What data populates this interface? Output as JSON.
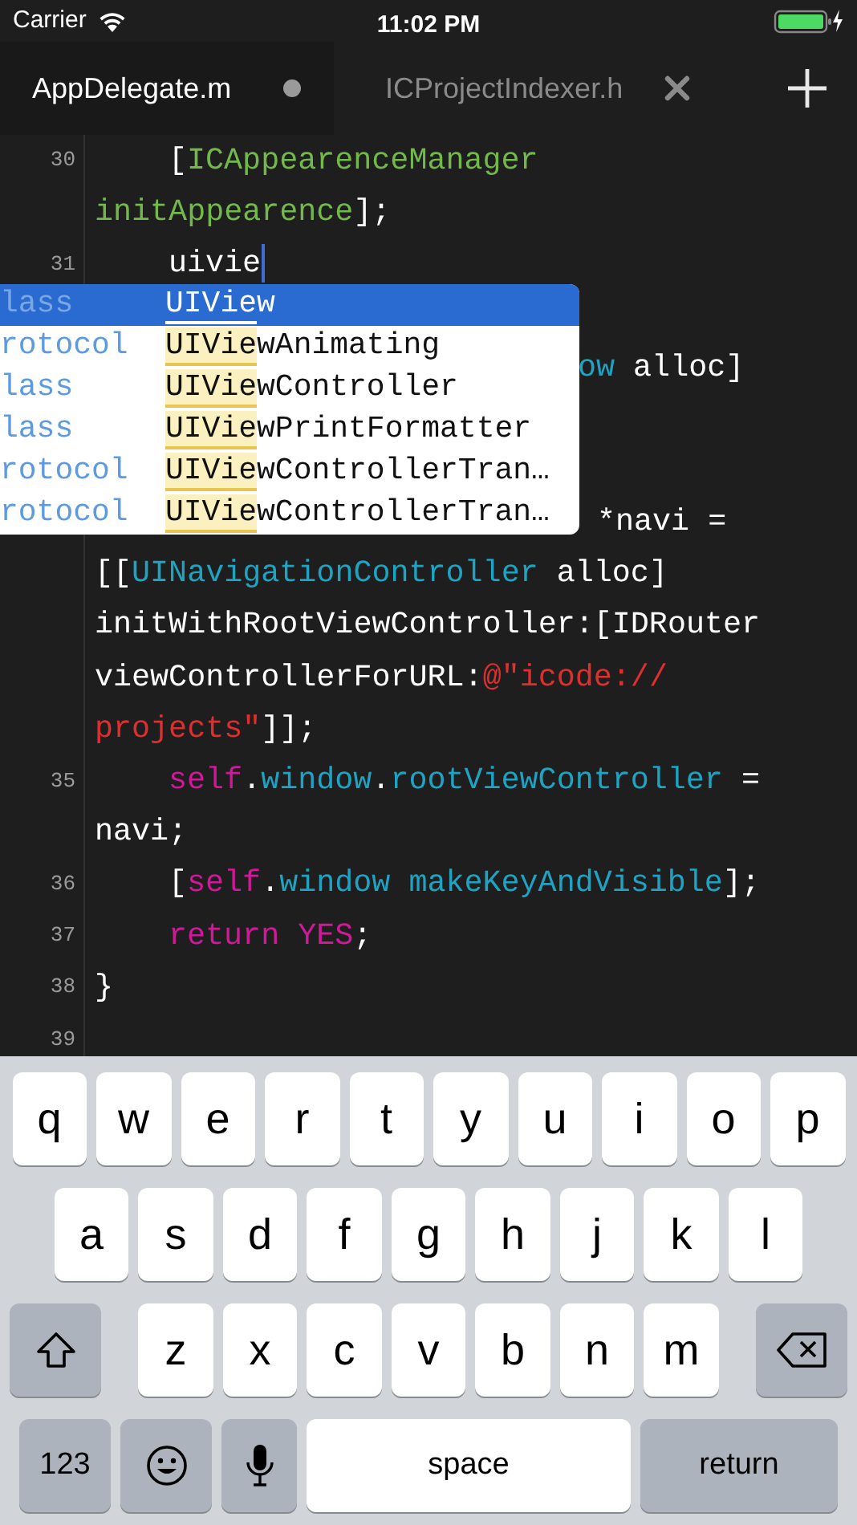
{
  "status_bar": {
    "carrier": "Carrier",
    "time": "11:02 PM"
  },
  "tabs": [
    {
      "label": "AppDelegate.m",
      "selected": true,
      "kind": "modified"
    },
    {
      "label": "ICProjectIndexer.h",
      "selected": false,
      "kind": "closable"
    }
  ],
  "editor": {
    "lines_before": [
      {
        "number": "30",
        "indent": true,
        "tokens": [
          {
            "t": "[",
            "kind": "plain"
          },
          {
            "t": "ICAppearenceManager",
            "kind": "project"
          }
        ]
      },
      {
        "tokens": [
          {
            "t": "initAppearence",
            "kind": "project"
          },
          {
            "t": "];",
            "kind": "plain"
          }
        ]
      },
      {
        "number": "31",
        "indent": true,
        "caret": true,
        "tokens": [
          {
            "t": "uivie",
            "kind": "plain"
          }
        ]
      }
    ],
    "fragments_beside_popup": [
      {
        "tokens": [
          {
            "t": "ow",
            "kind": "system"
          },
          {
            "t": " alloc]",
            "kind": "plain"
          }
        ]
      },
      {
        "tokens": [
          {
            "t": "*navi =",
            "kind": "plain"
          }
        ]
      }
    ],
    "lines_after": [
      {
        "tokens": [
          {
            "t": "[[",
            "kind": "plain"
          },
          {
            "t": "UINavigationController",
            "kind": "system"
          },
          {
            "t": " alloc]",
            "kind": "plain"
          }
        ]
      },
      {
        "tokens": [
          {
            "t": "initWithRootViewController:[IDRouter",
            "kind": "plain"
          }
        ]
      },
      {
        "tokens": [
          {
            "t": "viewControllerForURL:",
            "kind": "plain"
          },
          {
            "t": "@\"icode://",
            "kind": "string"
          }
        ]
      },
      {
        "tokens": [
          {
            "t": "projects\"",
            "kind": "string"
          },
          {
            "t": "]];",
            "kind": "plain"
          }
        ]
      },
      {
        "number": "35",
        "indent": true,
        "tokens": [
          {
            "t": "self",
            "kind": "keyword"
          },
          {
            "t": ".",
            "kind": "plain"
          },
          {
            "t": "window",
            "kind": "system"
          },
          {
            "t": ".",
            "kind": "plain"
          },
          {
            "t": "rootViewController",
            "kind": "system"
          },
          {
            "t": " =",
            "kind": "plain"
          }
        ]
      },
      {
        "tokens": [
          {
            "t": "navi;",
            "kind": "plain"
          }
        ]
      },
      {
        "number": "36",
        "indent": true,
        "tokens": [
          {
            "t": "[",
            "kind": "plain"
          },
          {
            "t": "self",
            "kind": "keyword"
          },
          {
            "t": ".",
            "kind": "plain"
          },
          {
            "t": "window",
            "kind": "system"
          },
          {
            "t": " makeKeyAndVisible",
            "kind": "system"
          },
          {
            "t": "];",
            "kind": "plain"
          }
        ]
      },
      {
        "number": "37",
        "indent": true,
        "tokens": [
          {
            "t": "return YES",
            "kind": "keyword"
          },
          {
            "t": ";",
            "kind": "plain"
          }
        ]
      },
      {
        "number": "38",
        "tokens": [
          {
            "t": "}",
            "kind": "plain"
          }
        ]
      },
      {
        "number": "39"
      }
    ]
  },
  "autocomplete": {
    "items": [
      {
        "kind_label": "lass",
        "match": "UIVie",
        "rest": "w",
        "selected": true
      },
      {
        "kind_label": "rotocol",
        "match": "UIVie",
        "rest": "wAnimating",
        "selected": false
      },
      {
        "kind_label": "lass",
        "match": "UIVie",
        "rest": "wController",
        "selected": false
      },
      {
        "kind_label": "lass",
        "match": "UIVie",
        "rest": "wPrintFormatter",
        "selected": false
      },
      {
        "kind_label": "rotocol",
        "match": "UIVie",
        "rest": "wControllerTran…",
        "selected": false
      },
      {
        "kind_label": "rotocol",
        "match": "UIVie",
        "rest": "wControllerTran…",
        "selected": false
      }
    ]
  },
  "keyboard": {
    "rows": [
      [
        {
          "kind": "letter",
          "label": "q"
        },
        {
          "kind": "letter",
          "label": "w"
        },
        {
          "kind": "letter",
          "label": "e"
        },
        {
          "kind": "letter",
          "label": "r"
        },
        {
          "kind": "letter",
          "label": "t"
        },
        {
          "kind": "letter",
          "label": "y"
        },
        {
          "kind": "letter",
          "label": "u"
        },
        {
          "kind": "letter",
          "label": "i"
        },
        {
          "kind": "letter",
          "label": "o"
        },
        {
          "kind": "letter",
          "label": "p"
        }
      ],
      [
        {
          "kind": "letter",
          "label": "a"
        },
        {
          "kind": "letter",
          "label": "s"
        },
        {
          "kind": "letter",
          "label": "d"
        },
        {
          "kind": "letter",
          "label": "f"
        },
        {
          "kind": "letter",
          "label": "g"
        },
        {
          "kind": "letter",
          "label": "h"
        },
        {
          "kind": "letter",
          "label": "j"
        },
        {
          "kind": "letter",
          "label": "k"
        },
        {
          "kind": "letter",
          "label": "l"
        }
      ],
      [
        {
          "kind": "shift"
        },
        {
          "kind": "letter",
          "label": "z"
        },
        {
          "kind": "letter",
          "label": "x"
        },
        {
          "kind": "letter",
          "label": "c"
        },
        {
          "kind": "letter",
          "label": "v"
        },
        {
          "kind": "letter",
          "label": "b"
        },
        {
          "kind": "letter",
          "label": "n"
        },
        {
          "kind": "letter",
          "label": "m"
        },
        {
          "kind": "delete"
        }
      ]
    ],
    "bottom_row": [
      {
        "kind": "mode",
        "label": "123"
      },
      {
        "kind": "emoji"
      },
      {
        "kind": "mic"
      },
      {
        "kind": "space",
        "label": "space"
      },
      {
        "kind": "return",
        "label": "return"
      }
    ]
  }
}
